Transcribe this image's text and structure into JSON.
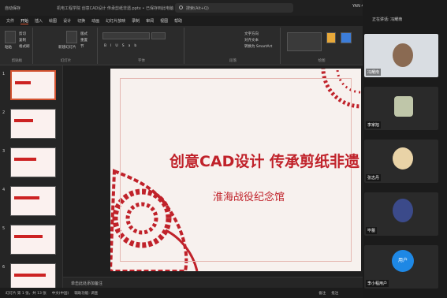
{
  "titlebar": {
    "autosave": "自动保存",
    "file": "机电工程学院 创意CAD设计 传承剪纸非遗.pptx • 已保存到此电脑",
    "search": "搜索(Alt+Q)",
    "user": "YAN 45"
  },
  "menu": [
    "文件",
    "开始",
    "插入",
    "绘图",
    "设计",
    "切换",
    "动画",
    "幻灯片放映",
    "录制",
    "审阅",
    "视图",
    "帮助"
  ],
  "menu_active": "开始",
  "ribbon": {
    "groups": [
      "剪贴板",
      "幻灯片",
      "字体",
      "段落",
      "绘图"
    ],
    "paste": "粘贴",
    "new_slide": "新建幻灯片",
    "clipboard_items": [
      "剪切",
      "复制",
      "格式刷"
    ],
    "slide_items": [
      "版式",
      "重置",
      "节"
    ],
    "para_items": [
      "文字方向",
      "对齐文本",
      "转换为 SmartArt"
    ]
  },
  "thumbnails": [
    {
      "num": "1"
    },
    {
      "num": "2"
    },
    {
      "num": "3"
    },
    {
      "num": "4"
    },
    {
      "num": "5"
    },
    {
      "num": "6"
    }
  ],
  "slide": {
    "title": "创意CAD设计 传承剪纸非遗",
    "subtitle": "淮海战役纪念馆"
  },
  "notes_placeholder": "单击此处添加备注",
  "status": {
    "slide_count": "幻灯片 第 1 张，共 13 张",
    "lang": "中文(中国)",
    "accessibility": "辅助功能: 调查",
    "notes": "备注",
    "comments": "批注"
  },
  "meeting": {
    "speaking": "正在讲话: 冯耀南",
    "participants": [
      {
        "name": "冯耀南"
      },
      {
        "name": "李家旭"
      },
      {
        "name": "张志丹"
      },
      {
        "name": "毕蕾"
      },
      {
        "name": "李小程用户",
        "avatar_text": "用户"
      }
    ]
  }
}
